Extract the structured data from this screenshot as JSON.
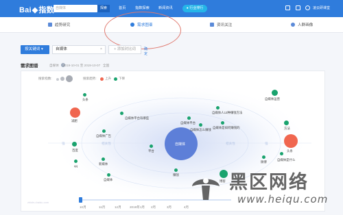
{
  "header": {
    "brand": "Bai",
    "brand_suffix": "指数",
    "search_placeholder": "自媒体",
    "search_button": "探索",
    "nav": [
      "首页",
      "指数探索",
      "新闻资讯"
    ],
    "nav_pill": "行业排行",
    "user": "凌云研课堂"
  },
  "tabs": [
    {
      "label": "趋势研究"
    },
    {
      "label": "需求图谱"
    },
    {
      "label": "资讯关注"
    },
    {
      "label": "人群画像"
    }
  ],
  "keywords": {
    "dropdown": "按关键词",
    "keyword": "自媒体",
    "close": "×",
    "add": "+ 添加对比词",
    "confirm": "确定"
  },
  "section": {
    "title": "需求图谱",
    "help": "?",
    "source": "自媒体",
    "date_range": "2019-10-01 至 2019-10-07",
    "scope": "全国"
  },
  "legend": {
    "search_index": "搜索指数:",
    "search_trend": "搜索趋势:",
    "up": "上升",
    "down": "下降"
  },
  "colors": {
    "up": "#f0664f",
    "down": "#1aa36e",
    "center": "#5d7fd8",
    "brand": "#2f7cdc"
  },
  "graph": {
    "center": "自媒体",
    "axis_left": "相关性",
    "axis_right": "相关性",
    "axis_far_left": "强",
    "axis_far_right": "强",
    "nodes": [
      {
        "label": "头条",
        "trend": "down"
      },
      {
        "label": "减肥",
        "trend": "up"
      },
      {
        "label": "自媒体广告",
        "trend": "down"
      },
      {
        "label": "自媒体运营",
        "trend": "down"
      },
      {
        "label": "百度",
        "trend": "down"
      },
      {
        "label": "qq",
        "trend": "down"
      },
      {
        "label": "新媒体",
        "trend": "down"
      },
      {
        "label": "自媒体",
        "trend": "down"
      },
      {
        "label": "平台",
        "trend": "down"
      },
      {
        "label": "自媒体平台有哪些",
        "trend": "down"
      },
      {
        "label": "自媒体平台",
        "trend": "down"
      },
      {
        "label": "自媒体怎么赚钱",
        "trend": "down"
      },
      {
        "label": "赚钱",
        "trend": "down"
      },
      {
        "label": "自媒体人13种赚钱方法",
        "trend": "down"
      },
      {
        "label": "自媒体是如何赚钱的",
        "trend": "down"
      },
      {
        "label": "自媒体运营",
        "trend": "down"
      },
      {
        "label": "方法",
        "trend": "down"
      },
      {
        "label": "头条",
        "trend": "up"
      },
      {
        "label": "微博",
        "trend": "down"
      },
      {
        "label": "博客",
        "trend": "down"
      },
      {
        "label": "自媒体是什么",
        "trend": "down"
      }
    ]
  },
  "timeline": [
    "10月",
    "11月",
    "12月",
    "2019年1月",
    "2月",
    "3月",
    "4月"
  ],
  "footer_mark": "zhishu.baidu.com",
  "watermark": {
    "title": "黑区网络",
    "url": "www.heiqu.com"
  }
}
